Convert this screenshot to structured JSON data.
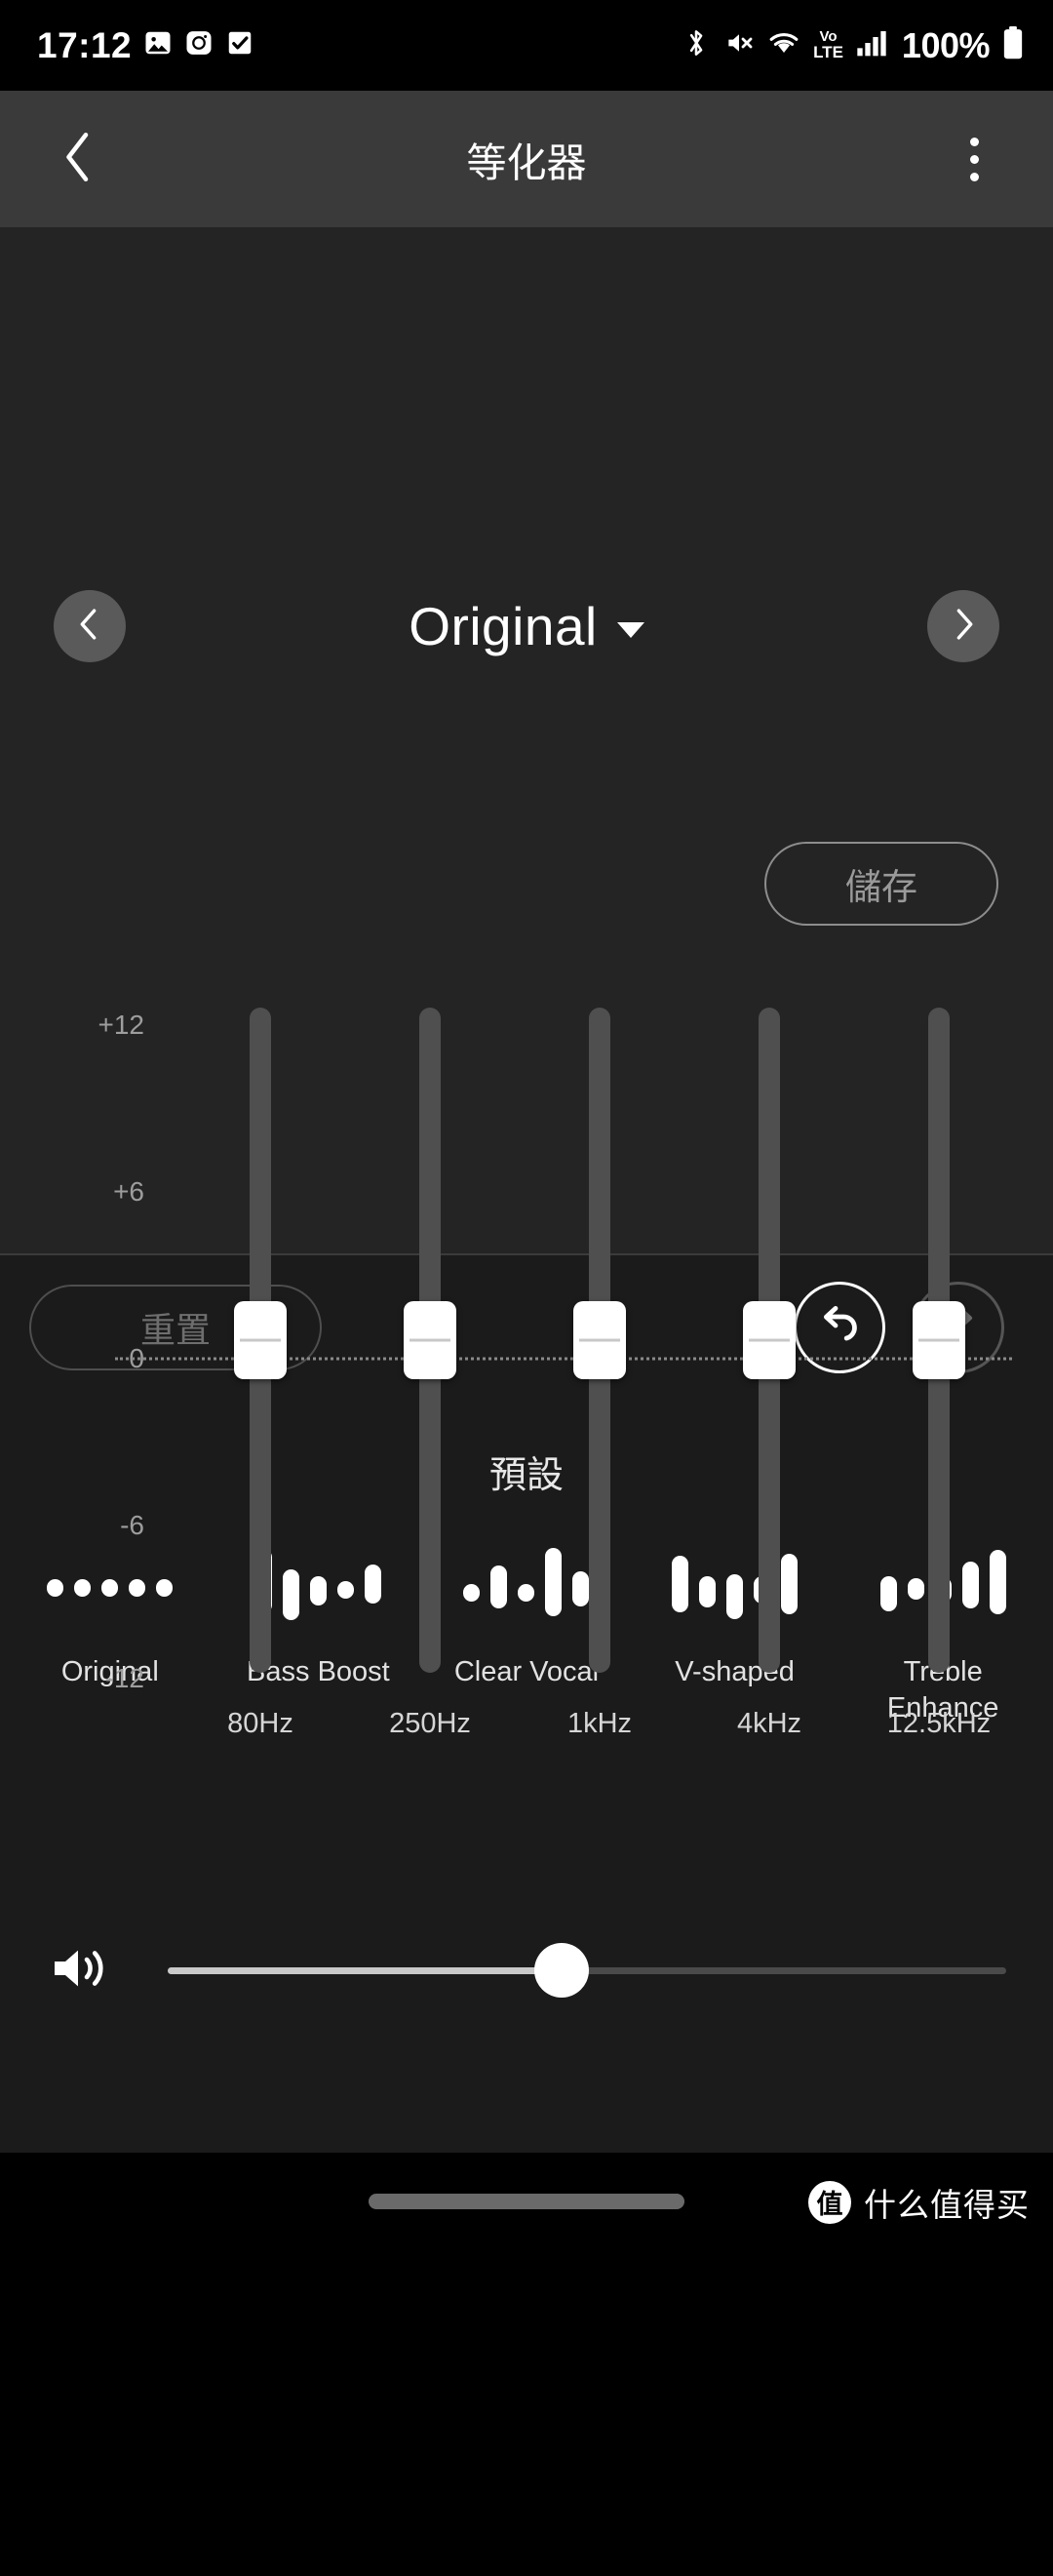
{
  "status_bar": {
    "time": "17:12",
    "battery_percent": "100%",
    "volte_top": "VoLTE",
    "volte_line1": "Vo",
    "volte_line2": "LTE",
    "left_icons": [
      "gallery-icon",
      "instagram-icon",
      "checkbox-icon"
    ],
    "right_icons": [
      "bluetooth-icon",
      "volume-mute-icon",
      "wifi-icon",
      "volte-icon",
      "cellular-signal-icon",
      "battery-icon"
    ]
  },
  "app_bar": {
    "title": "等化器",
    "back_icon": "chevron-left-icon",
    "menu_icon": "overflow-menu-icon"
  },
  "equalizer": {
    "preset_selected": "Original",
    "prev_icon": "chevron-left-icon",
    "next_icon": "chevron-right-icon",
    "dropdown_icon": "chevron-down-icon",
    "save_label": "儲存",
    "y_labels": [
      "+12",
      "+6",
      "0",
      "-6",
      "-12"
    ],
    "bands": [
      {
        "freq": "80Hz",
        "gain": 0
      },
      {
        "freq": "250Hz",
        "gain": 0
      },
      {
        "freq": "1kHz",
        "gain": 0
      },
      {
        "freq": "4kHz",
        "gain": 0
      },
      {
        "freq": "12.5kHz",
        "gain": 0
      }
    ],
    "range_min": -12,
    "range_max": 12
  },
  "actions": {
    "reset_label": "重置",
    "undo_icon": "undo-arrow-icon",
    "redo_icon": "redo-arrow-icon",
    "undo_enabled": true,
    "redo_enabled": false
  },
  "presets": {
    "heading": "預設",
    "items": [
      {
        "label": "Original",
        "bars": [
          18,
          18,
          18,
          18,
          18
        ],
        "offsets": [
          0,
          0,
          0,
          0,
          0
        ]
      },
      {
        "label": "Bass Boost",
        "bars": [
          66,
          52,
          30,
          18,
          40
        ],
        "offsets": [
          -14,
          14,
          6,
          4,
          -8
        ]
      },
      {
        "label": "Clear Vocal",
        "bars": [
          18,
          44,
          18,
          70,
          36
        ],
        "offsets": [
          10,
          -2,
          10,
          -12,
          2
        ]
      },
      {
        "label": "V-shaped",
        "bars": [
          58,
          32,
          46,
          28,
          62
        ],
        "offsets": [
          -8,
          8,
          18,
          4,
          -8
        ]
      },
      {
        "label": "Treble Enhance",
        "bars": [
          36,
          22,
          26,
          48,
          66
        ],
        "offsets": [
          12,
          2,
          4,
          -6,
          -12
        ]
      }
    ]
  },
  "volume": {
    "icon": "speaker-volume-icon",
    "value_percent": 47
  },
  "nav": {
    "gesture_bar": "home-gesture-bar"
  },
  "watermark": {
    "logo_char": "值",
    "text": "什么值得买"
  },
  "colors": {
    "status_bg": "#000000",
    "appbar_bg": "#3a3a3a",
    "panel_bg": "#242424",
    "section_bg": "#1b1b1b",
    "track": "#4f4f4f",
    "thumb": "#ffffff",
    "muted_text": "#9a9a9a"
  }
}
